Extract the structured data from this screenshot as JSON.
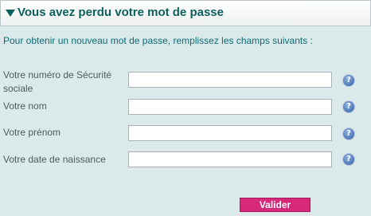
{
  "header": {
    "title": "Vous avez perdu votre mot de passe"
  },
  "intro": "Pour obtenir un nouveau mot de passe, remplissez les champs suivants :",
  "fields": [
    {
      "label": "Votre numéro de Sécurité sociale",
      "value": ""
    },
    {
      "label": "Votre nom",
      "value": ""
    },
    {
      "label": "Votre prénom",
      "value": ""
    },
    {
      "label": "Votre date de naissance",
      "value": ""
    }
  ],
  "help_icon": {
    "icon": "question-icon",
    "glyph": "?"
  },
  "submit": {
    "label": "Valider"
  },
  "colors": {
    "accent": "#0b5f5f",
    "intro_text": "#0b6d76",
    "button": "#d8287a",
    "background": "#dbe9ea"
  }
}
